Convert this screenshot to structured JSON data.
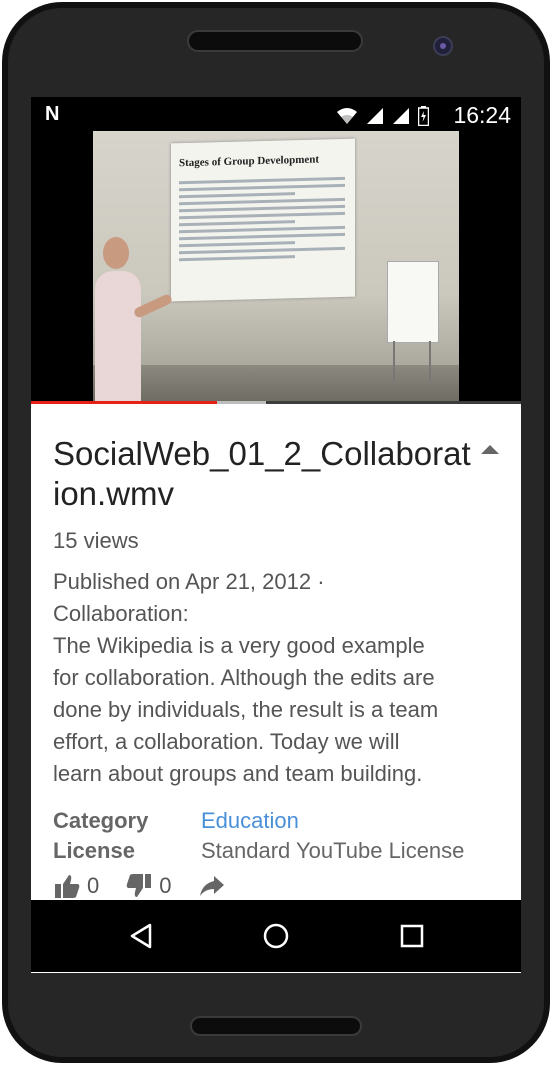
{
  "status_bar": {
    "notification_icon": "N",
    "icons": [
      "wifi-icon",
      "signal-icon",
      "signal-icon",
      "battery-icon"
    ],
    "time": "16:24"
  },
  "video": {
    "progress_fraction": 0.38,
    "buffer_fraction": 0.48,
    "slide_title": "Stages of Group Development"
  },
  "info": {
    "title": "SocialWeb_01_2_Collaboration.wmv",
    "views": "15 views",
    "description_lines": [
      "Published on Apr 21, 2012 ·",
      "Collaboration:",
      "The Wikipedia is a very good example",
      "for collaboration.  Although the edits are",
      "done by individuals, the result is a team",
      "effort, a collaboration.  Today we will",
      "learn about groups and team building."
    ],
    "category_label": "Category",
    "category_value": "Education",
    "license_label": "License",
    "license_value": "Standard YouTube License",
    "likes": "0",
    "dislikes": "0"
  },
  "colors": {
    "progress": "#e62117",
    "link": "#4a90d9"
  },
  "nav": {
    "icons": [
      "back-icon",
      "home-icon",
      "recents-icon"
    ]
  }
}
